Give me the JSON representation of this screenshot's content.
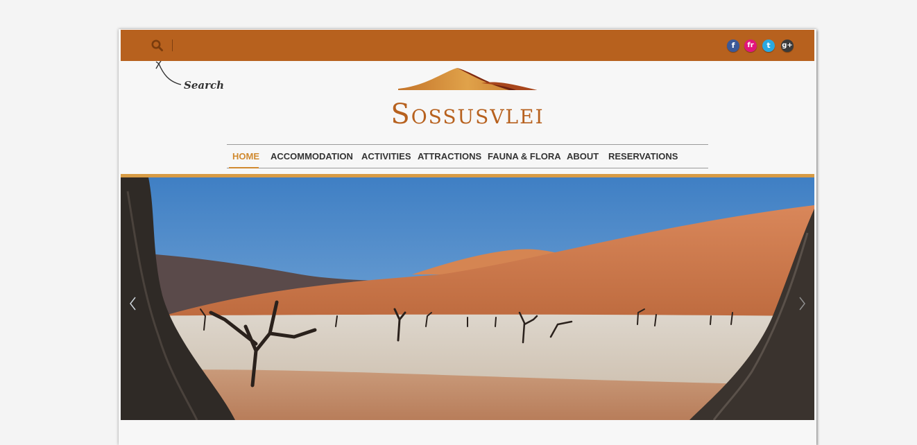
{
  "search": {
    "placeholder": "",
    "hint_label": "Search"
  },
  "social": [
    {
      "name": "facebook",
      "glyph": "f",
      "color": "#3b5998"
    },
    {
      "name": "french",
      "glyph": "fr",
      "color": "#e2157b"
    },
    {
      "name": "twitter",
      "glyph": "t",
      "color": "#2aa9e0"
    },
    {
      "name": "google-plus",
      "glyph": "g+",
      "color": "#3a3a3a"
    }
  ],
  "brand": {
    "name": "Sossusvlei",
    "primary_color": "#b7611e",
    "accent_color": "#d0892f"
  },
  "nav": {
    "items": [
      {
        "label": "HOME",
        "active": true
      },
      {
        "label": "ACCOMMODATION",
        "active": false
      },
      {
        "label": "ACTIVITIES",
        "active": false
      },
      {
        "label": "ATTRACTIONS",
        "active": false
      },
      {
        "label": "FAUNA & FLORA",
        "active": false
      },
      {
        "label": "ABOUT",
        "active": false
      },
      {
        "label": "RESERVATIONS",
        "active": false
      }
    ]
  },
  "hero": {
    "image_subject": "deadvlei-dunes-with-dead-camelthorn-trees",
    "prev_icon": "chevron-left-icon",
    "next_icon": "chevron-right-icon"
  }
}
